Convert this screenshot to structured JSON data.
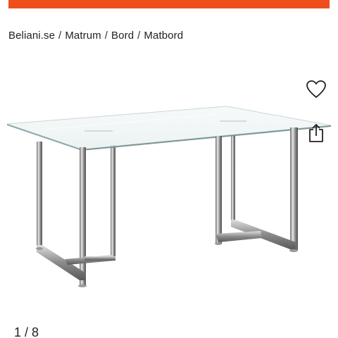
{
  "banner": {
    "color": "#ee4d1c"
  },
  "breadcrumb": {
    "separator": "/",
    "items": [
      {
        "label": "Beliani.se"
      },
      {
        "label": "Matrum"
      },
      {
        "label": "Bord"
      },
      {
        "label": "Matbord"
      }
    ]
  },
  "actions": {
    "wishlist_icon": "heart-icon",
    "share_icon": "share-icon"
  },
  "gallery": {
    "counter": "1 / 8"
  }
}
